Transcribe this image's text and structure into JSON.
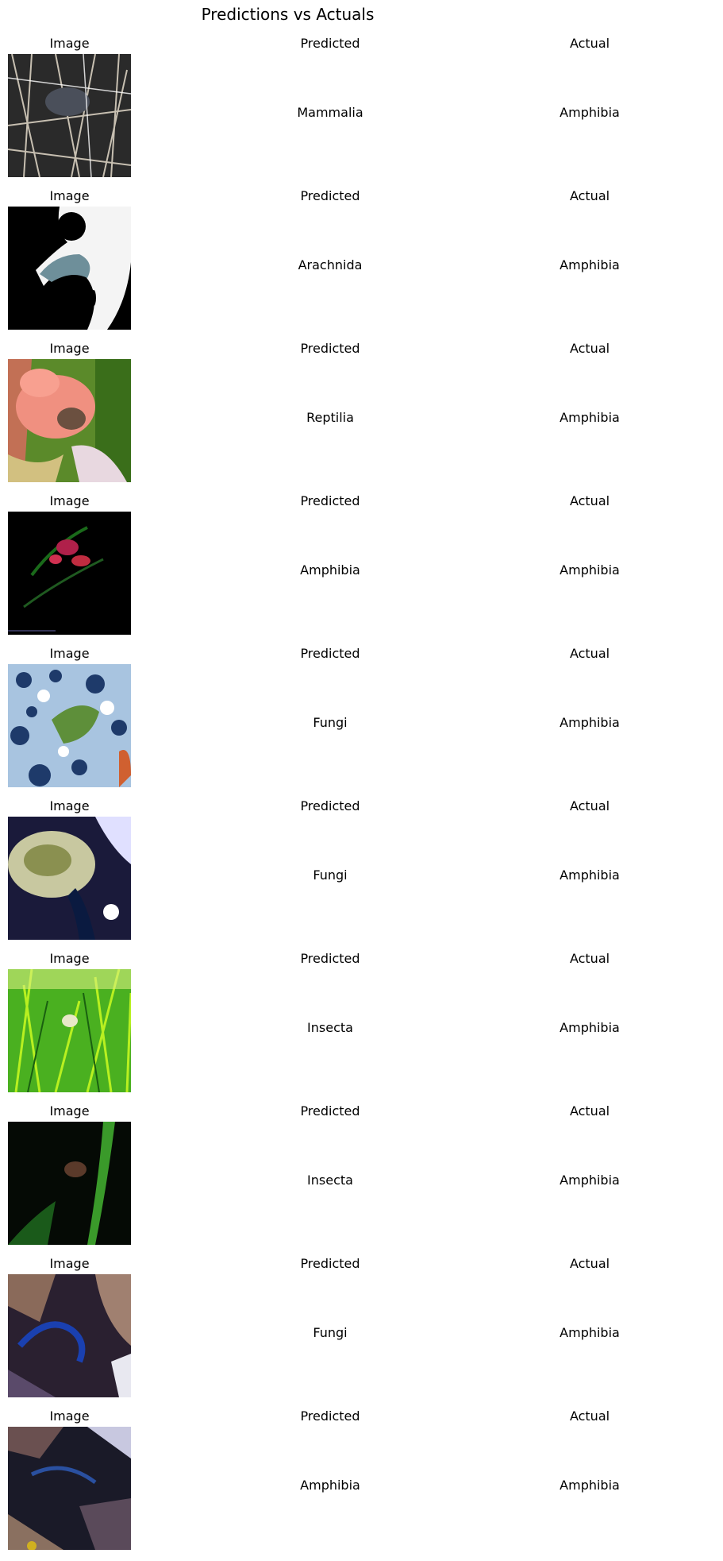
{
  "chart_data": {
    "type": "table",
    "title": "Predictions vs Actuals",
    "columns": [
      "Image",
      "Predicted",
      "Actual"
    ],
    "rows": [
      {
        "predicted": "Mammalia",
        "actual": "Amphibia"
      },
      {
        "predicted": "Arachnida",
        "actual": "Amphibia"
      },
      {
        "predicted": "Reptilia",
        "actual": "Amphibia"
      },
      {
        "predicted": "Amphibia",
        "actual": "Amphibia"
      },
      {
        "predicted": "Fungi",
        "actual": "Amphibia"
      },
      {
        "predicted": "Fungi",
        "actual": "Amphibia"
      },
      {
        "predicted": "Insecta",
        "actual": "Amphibia"
      },
      {
        "predicted": "Insecta",
        "actual": "Amphibia"
      },
      {
        "predicted": "Fungi",
        "actual": "Amphibia"
      },
      {
        "predicted": "Amphibia",
        "actual": "Amphibia"
      }
    ]
  }
}
